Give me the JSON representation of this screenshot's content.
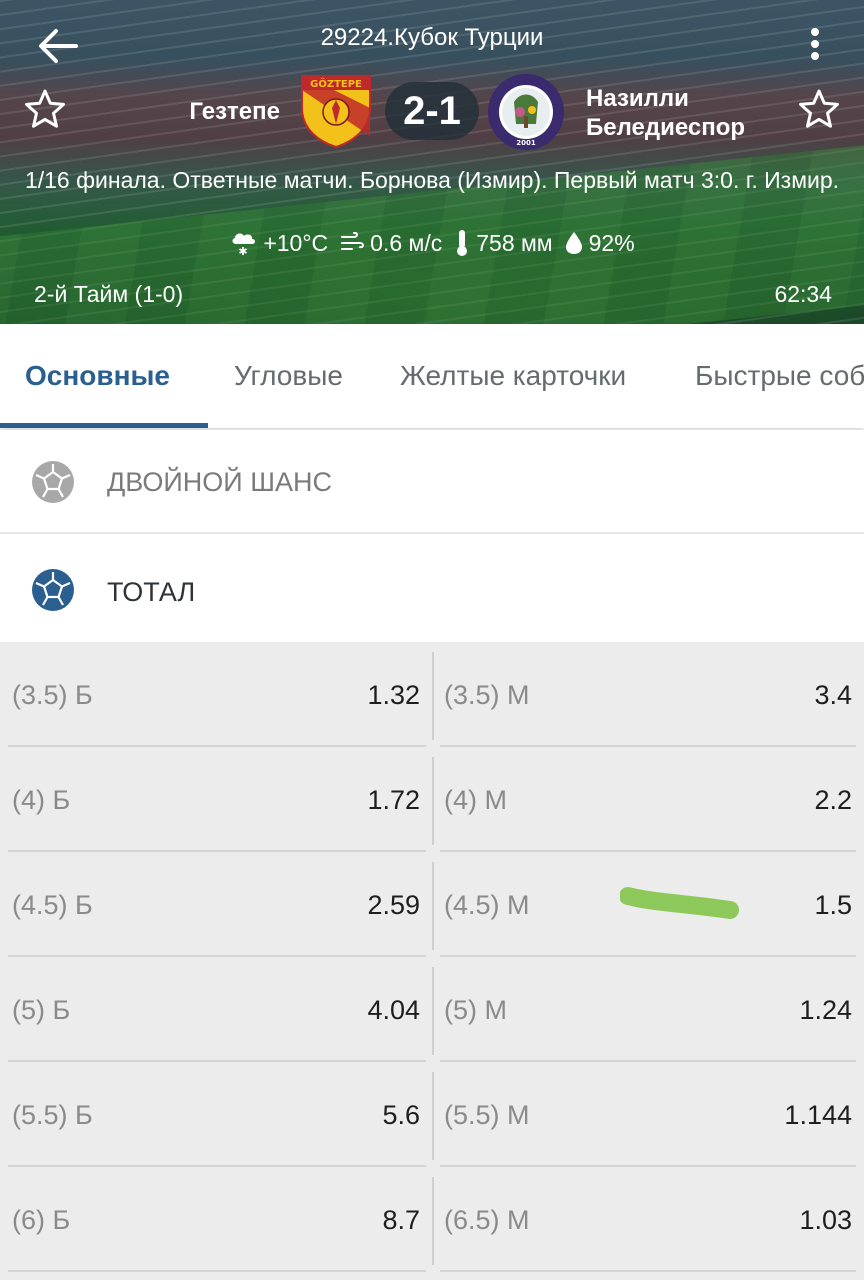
{
  "header": {
    "tournament": "29224.Кубок Турции",
    "home_team": "Гезтепе",
    "home_logo_text": "GÖZTEPE",
    "score": "2-1",
    "away_team_line1": "Назилли",
    "away_team_line2": "Беледиеспор",
    "away_logo_text": "NAZİLLİ BELEDİYE SPOR 2001",
    "stage_info": "1/16 финала. Ответные матчи. Борнова (Измир). Первый матч 3:0. г. Измир.",
    "weather": {
      "temperature": "+10°C",
      "wind": "0.6 м/с",
      "pressure": "758 мм",
      "humidity": "92%"
    },
    "period": "2-й  Тайм (1-0)",
    "clock": "62:34"
  },
  "tabs": [
    {
      "label": "Основные",
      "active": true
    },
    {
      "label": "Угловые",
      "active": false
    },
    {
      "label": "Желтые карточки",
      "active": false
    },
    {
      "label": "Быстрые события",
      "active": false
    }
  ],
  "sections": {
    "double_chance": "ДВОЙНОЙ ШАНС",
    "total": "ТОТАЛ"
  },
  "totals": [
    {
      "over_label": "(3.5) Б",
      "over_odds": "1.32",
      "under_label": "(3.5) М",
      "under_odds": "3.4"
    },
    {
      "over_label": "(4) Б",
      "over_odds": "1.72",
      "under_label": "(4) М",
      "under_odds": "2.2"
    },
    {
      "over_label": "(4.5) Б",
      "over_odds": "2.59",
      "under_label": "(4.5) М",
      "under_odds": "1.5"
    },
    {
      "over_label": "(5) Б",
      "over_odds": "4.04",
      "under_label": "(5) М",
      "under_odds": "1.24"
    },
    {
      "over_label": "(5.5) Б",
      "over_odds": "5.6",
      "under_label": "(5.5) М",
      "under_odds": "1.144"
    },
    {
      "over_label": "(6) Б",
      "over_odds": "8.7",
      "under_label": "(6.5) М",
      "under_odds": "1.03"
    }
  ],
  "colors": {
    "accent": "#2a5f8f",
    "highlight_marker": "#8cc95a"
  }
}
